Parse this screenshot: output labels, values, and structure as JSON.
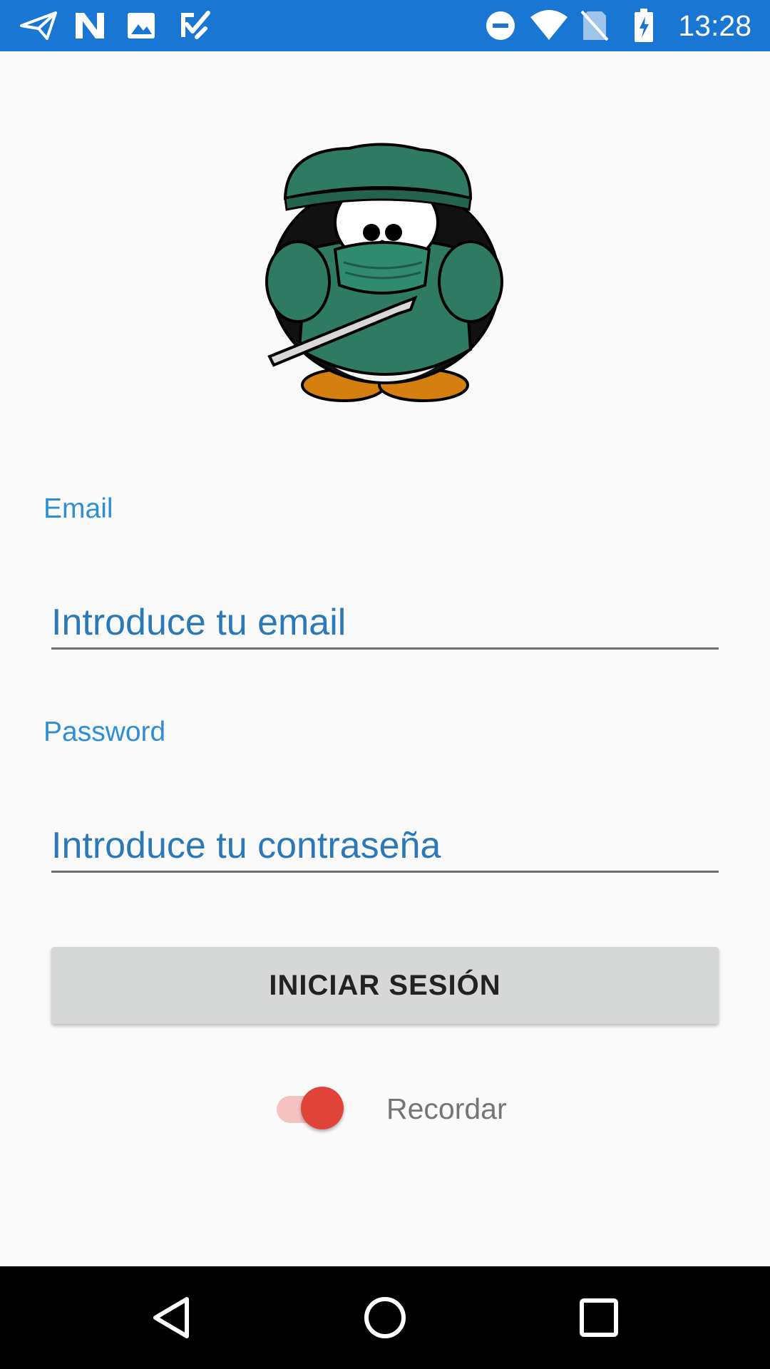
{
  "status_bar": {
    "time": "13:28",
    "left_icons": [
      "send-icon",
      "n-notification-icon",
      "image-icon",
      "checklist-icon"
    ],
    "right_icons": [
      "do-not-disturb-icon",
      "wifi-icon",
      "no-sim-icon",
      "battery-charging-icon"
    ]
  },
  "logo": {
    "icon": "surgeon-penguin-logo"
  },
  "form": {
    "email_label": "Email",
    "email_placeholder": "Introduce tu email",
    "email_value": "",
    "password_label": "Password",
    "password_placeholder": "Introduce tu contraseña",
    "password_value": "",
    "login_button": "INICIAR SESIÓN",
    "remember_label": "Recordar",
    "remember_on": true
  },
  "nav_bar": {
    "buttons": [
      "back-icon",
      "home-icon",
      "recents-icon"
    ]
  },
  "colors": {
    "status_bar": "#1976d2",
    "accent": "#2f8fd6",
    "switch_thumb": "#e04338",
    "switch_track": "#f4c2c0",
    "button_bg": "#d6d7d7"
  }
}
